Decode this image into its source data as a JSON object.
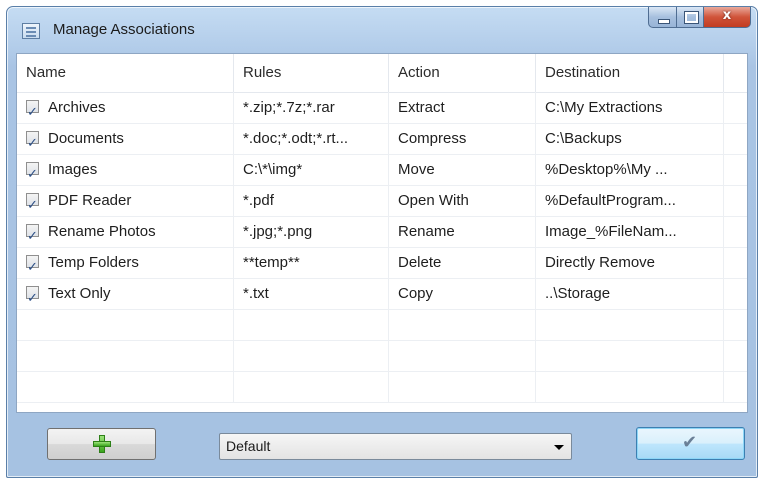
{
  "window": {
    "title": "Manage Associations",
    "close_glyph": "x",
    "icon": "list-window-icon"
  },
  "table": {
    "columns": [
      "Name",
      "Rules",
      "Action",
      "Destination"
    ],
    "rows": [
      {
        "checked": true,
        "name": "Archives",
        "rules": "*.zip;*.7z;*.rar",
        "action": "Extract",
        "destination": "C:\\My Extractions"
      },
      {
        "checked": true,
        "name": "Documents",
        "rules": "*.doc;*.odt;*.rt...",
        "action": "Compress",
        "destination": "C:\\Backups"
      },
      {
        "checked": true,
        "name": "Images",
        "rules": "C:\\*\\img*",
        "action": "Move",
        "destination": "%Desktop%\\My ..."
      },
      {
        "checked": true,
        "name": "PDF Reader",
        "rules": "*.pdf",
        "action": "Open With",
        "destination": "%DefaultProgram..."
      },
      {
        "checked": true,
        "name": "Rename Photos",
        "rules": "*.jpg;*.png",
        "action": "Rename",
        "destination": "Image_%FileNam..."
      },
      {
        "checked": true,
        "name": "Temp Folders",
        "rules": "**temp**",
        "action": "Delete",
        "destination": "Directly Remove"
      },
      {
        "checked": true,
        "name": "Text Only",
        "rules": "*.txt",
        "action": "Copy",
        "destination": "..\\Storage"
      }
    ]
  },
  "bottom": {
    "add_icon": "plus-icon",
    "profile_selected": "Default",
    "ok_icon": "checkmark-icon"
  }
}
